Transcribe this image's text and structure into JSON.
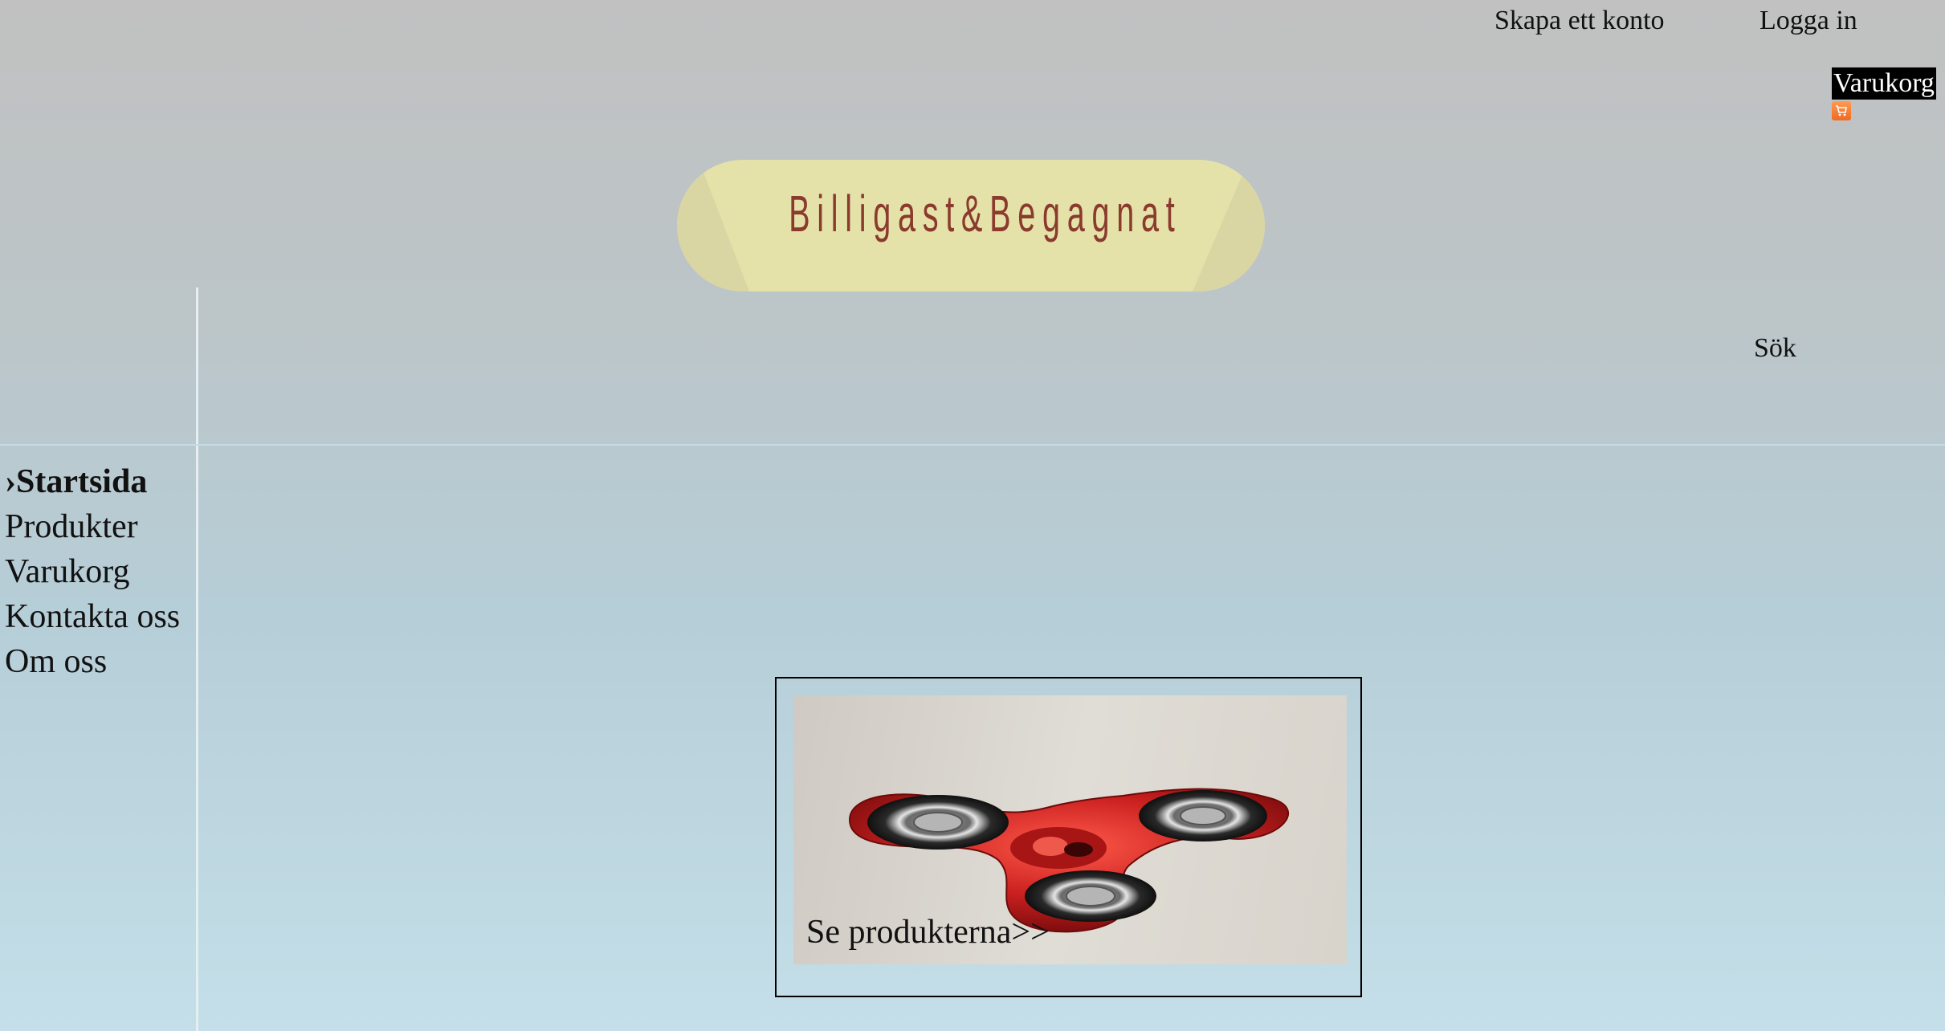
{
  "header": {
    "create_account": "Skapa ett konto",
    "login": "Logga in",
    "cart_label": "Varukorg",
    "cart_icon": "shopping-cart-icon",
    "logo_text": "Billigast&Begagnat",
    "search_label": "Sök"
  },
  "sidebar": {
    "items": [
      {
        "label": "›Startsida",
        "active": true
      },
      {
        "label": "Produkter"
      },
      {
        "label": "Varukorg"
      },
      {
        "label": "Kontakta oss"
      },
      {
        "label": "Om oss"
      }
    ]
  },
  "main": {
    "promo": {
      "image": "fidget-spinner-image",
      "caption": "Se produkterna>>"
    }
  },
  "colors": {
    "logo_background": "#e4e2a8",
    "logo_text": "#8b3a2e",
    "cart_label_background": "#000000",
    "spinner_red": "#c92a2a"
  }
}
